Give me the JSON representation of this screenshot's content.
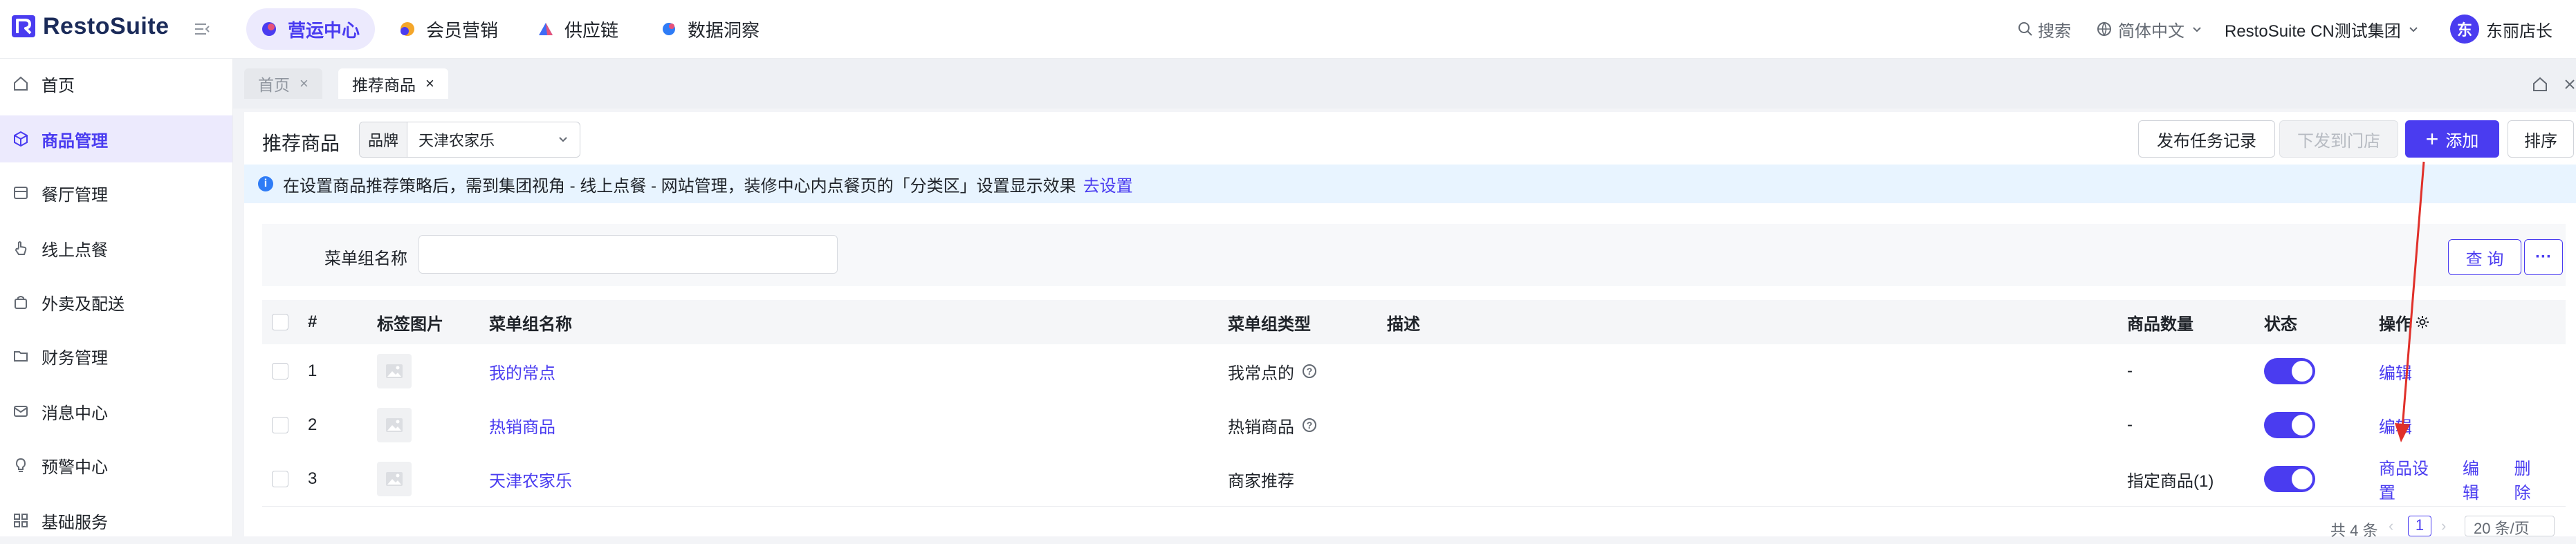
{
  "app": {
    "name": "RestoSuite"
  },
  "topnav": {
    "tabs": [
      {
        "label": "营运中心",
        "color": "#4a3cf0"
      },
      {
        "label": "会员营销",
        "color": "#f4a62a"
      },
      {
        "label": "供应链",
        "color": "#3f6bf6"
      },
      {
        "label": "数据洞察",
        "color": "#2f7cf6"
      }
    ],
    "search_label": "搜索",
    "language_label": "简体中文",
    "org_label": "RestoSuite CN测试集团",
    "avatar_char": "东",
    "user_name": "东丽店长"
  },
  "sidebar": {
    "items": [
      {
        "label": "首页"
      },
      {
        "label": "商品管理"
      },
      {
        "label": "餐厅管理"
      },
      {
        "label": "线上点餐"
      },
      {
        "label": "外卖及配送"
      },
      {
        "label": "财务管理"
      },
      {
        "label": "消息中心"
      },
      {
        "label": "预警中心"
      },
      {
        "label": "基础服务"
      }
    ]
  },
  "page_tabs": [
    {
      "label": "首页"
    },
    {
      "label": "推荐商品"
    }
  ],
  "header": {
    "title": "推荐商品",
    "brand_label": "品牌",
    "brand_value": "天津农家乐",
    "btn_task_log": "发布任务记录",
    "btn_push": "下发到门店",
    "btn_add": "添加",
    "btn_sort": "排序"
  },
  "notice": {
    "text": "在设置商品推荐策略后，需到集团视角 - 线上点餐 - 网站管理，装修中心内点餐页的「分类区」设置显示效果",
    "link": "去设置"
  },
  "filter": {
    "label": "菜单组名称",
    "value": "",
    "btn_query": "查 询",
    "btn_more": "···"
  },
  "table": {
    "columns": {
      "index": "#",
      "image": "标签图片",
      "name": "菜单组名称",
      "type": "菜单组类型",
      "desc": "描述",
      "count": "商品数量",
      "status": "状态",
      "actions": "操作"
    },
    "rows": [
      {
        "index": "1",
        "name": "我的常点",
        "type": "我常点的",
        "has_help": true,
        "desc": "",
        "count": "-",
        "status_on": true,
        "actions": [
          "编辑"
        ]
      },
      {
        "index": "2",
        "name": "热销商品",
        "type": "热销商品",
        "has_help": true,
        "desc": "",
        "count": "-",
        "status_on": true,
        "actions": [
          "编辑"
        ]
      },
      {
        "index": "3",
        "name": "天津农家乐",
        "type": "商家推荐",
        "has_help": false,
        "desc": "",
        "count": "指定商品(1)",
        "status_on": true,
        "actions": [
          "商品设置",
          "编辑",
          "删除"
        ]
      }
    ]
  },
  "pagination": {
    "total": "共 4 条",
    "current_page": "1",
    "page_size": "20 条/页"
  },
  "colors": {
    "accent": "#4a3cf0",
    "annotation_arrow": "#e0302a"
  }
}
